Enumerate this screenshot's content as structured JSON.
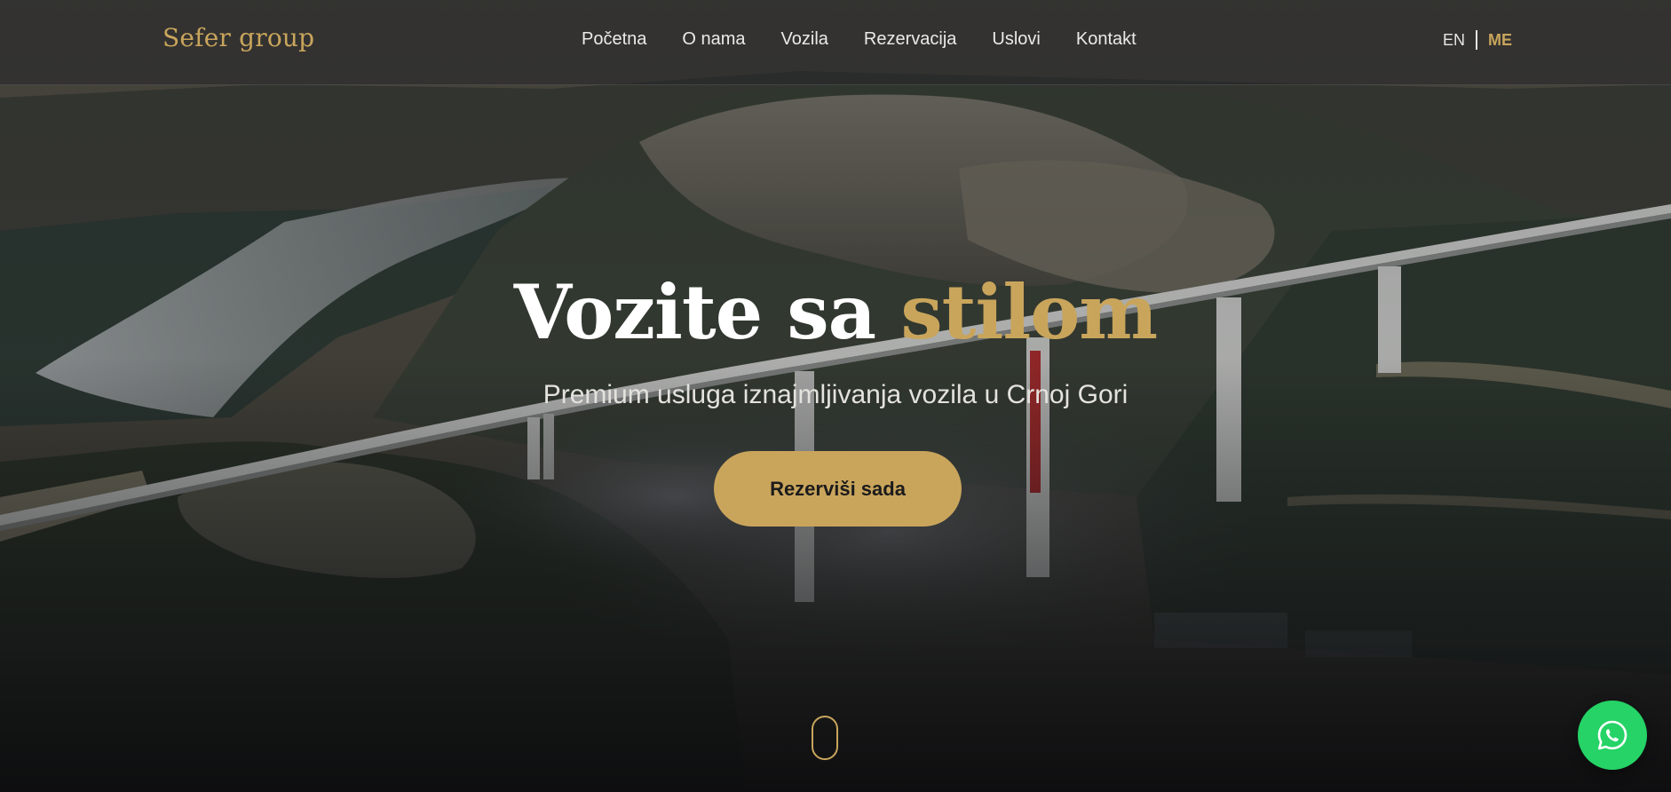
{
  "header": {
    "logo": "Sefer group",
    "nav": [
      {
        "label": "Početna"
      },
      {
        "label": "O nama"
      },
      {
        "label": "Vozila"
      },
      {
        "label": "Rezervacija"
      },
      {
        "label": "Uslovi"
      },
      {
        "label": "Kontakt"
      }
    ],
    "languages": {
      "en": "EN",
      "me": "ME",
      "active": "ME"
    }
  },
  "hero": {
    "title_main": "Vozite sa ",
    "title_accent": "stilom",
    "subtitle": "Premium usluga iznajmljivanja vozila u Crnoj Gori",
    "cta_label": "Rezerviši sada"
  },
  "icons": {
    "scroll": "mouse-scroll-icon",
    "whatsapp": "whatsapp-icon"
  },
  "colors": {
    "accent": "#c9a55c",
    "whatsapp": "#25d366",
    "header_bg": "#242628"
  }
}
